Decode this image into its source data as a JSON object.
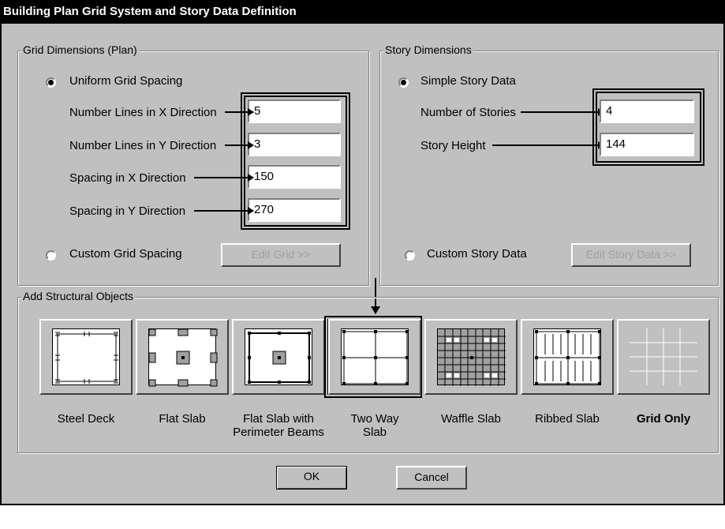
{
  "title": "Building Plan Grid System and Story Data Definition",
  "grid": {
    "legend": "Grid Dimensions (Plan)",
    "uniform_label": "Uniform Grid Spacing",
    "custom_label": "Custom Grid Spacing",
    "edit_button": "Edit Grid >>",
    "fields": [
      {
        "label": "Number Lines in X Direction",
        "value": "5"
      },
      {
        "label": "Number Lines in Y Direction",
        "value": "3"
      },
      {
        "label": "Spacing in X Direction",
        "value": "150"
      },
      {
        "label": "Spacing in Y Direction",
        "value": "270"
      }
    ]
  },
  "story": {
    "legend": "Story Dimensions",
    "simple_label": "Simple Story Data",
    "custom_label": "Custom Story Data",
    "edit_button": "Edit Story Data >>",
    "fields": [
      {
        "label": "Number of Stories",
        "value": "4"
      },
      {
        "label": "Story Height",
        "value": "144"
      }
    ]
  },
  "objects": {
    "legend": "Add Structural Objects",
    "items": [
      {
        "line1": "Steel Deck",
        "line2": "",
        "icon": "steel-deck-icon"
      },
      {
        "line1": "Flat Slab",
        "line2": "",
        "icon": "flat-slab-icon"
      },
      {
        "line1": "Flat Slab with",
        "line2": "Perimeter Beams",
        "icon": "flat-slab-perimeter-beams-icon"
      },
      {
        "line1": "Two Way",
        "line2": "Slab",
        "icon": "two-way-slab-icon"
      },
      {
        "line1": "Waffle Slab",
        "line2": "",
        "icon": "waffle-slab-icon"
      },
      {
        "line1": "Ribbed Slab",
        "line2": "",
        "icon": "ribbed-slab-icon"
      },
      {
        "line1": "Grid Only",
        "line2": "",
        "icon": "grid-only-icon"
      }
    ],
    "selected": "Two Way Slab"
  },
  "buttons": {
    "ok": "OK",
    "cancel": "Cancel"
  }
}
